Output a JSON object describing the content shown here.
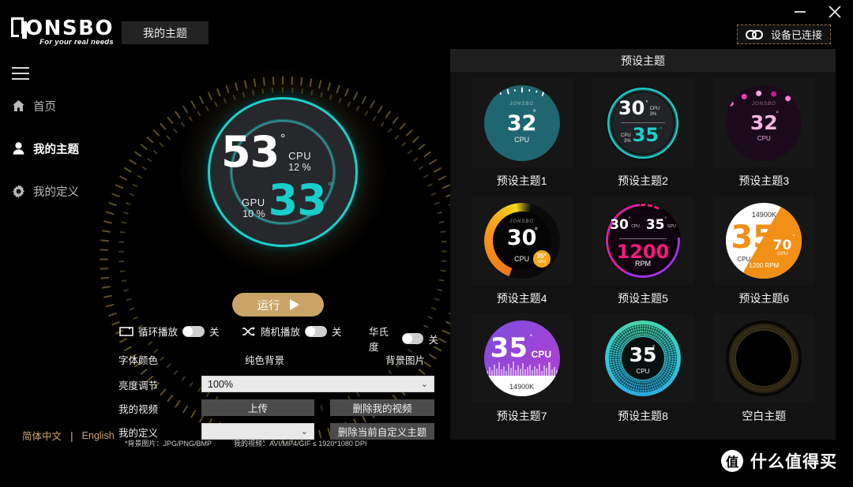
{
  "window": {
    "minimize": "–",
    "close": "✕"
  },
  "brand": {
    "name": "ONSBO",
    "tagline": "For your real needs"
  },
  "tab": {
    "label": "我的主题"
  },
  "device": {
    "status": "设备已连接",
    "icon": "link-icon"
  },
  "sidebar": {
    "menu_icon": "hamburger-icon",
    "items": [
      {
        "label": "首页",
        "icon": "home-icon",
        "active": false
      },
      {
        "label": "我的主题",
        "icon": "user-icon",
        "active": true
      },
      {
        "label": "我的定义",
        "icon": "gear-icon",
        "active": false
      }
    ]
  },
  "language": {
    "zh": "简体中文",
    "sep": "|",
    "en": "English"
  },
  "preview": {
    "cpu_value": "53",
    "cpu_degree": "°",
    "cpu_label": "CPU",
    "cpu_load": "12 %",
    "gpu_value": "33",
    "gpu_degree": "°",
    "gpu_label": "GPU",
    "gpu_load": "10 %",
    "accent": "#19cfcc",
    "ring": "#6d5a2d"
  },
  "run_button": {
    "label": "运行",
    "icon": "play-icon",
    "color": "#c9a367"
  },
  "toggles": [
    {
      "label": "循环播放",
      "state": "关",
      "icon": "loop-icon"
    },
    {
      "label": "随机播放",
      "state": "关",
      "icon": "shuffle-icon"
    },
    {
      "label": "华氏度",
      "state": "关",
      "icon": "none"
    }
  ],
  "option_labels": [
    "字体颜色",
    "纯色背景",
    "背景图片"
  ],
  "form": {
    "brightness": {
      "label": "亮度调节",
      "value": "100%",
      "placeholder": "100%"
    },
    "my_video": {
      "label": "我的视频",
      "upload": "上传",
      "delete": "删除我的视频"
    },
    "my_custom": {
      "label": "我的定义",
      "value": "",
      "placeholder": "",
      "delete": "删除当前自定义主题"
    }
  },
  "notes": [
    "*背景图片：JPG/PNG/BMP",
    "我的视频：AVI/MP4/GIF ≤ 1920*1080 DPI"
  ],
  "presets": {
    "title": "预设主题",
    "items": [
      {
        "id": "t1",
        "caption": "预设主题1",
        "brand": "JONSBO",
        "value": "32",
        "degree": "°",
        "label": "CPU"
      },
      {
        "id": "t2",
        "caption": "预设主题2",
        "value1": "30",
        "unit1": "CPU",
        "load1": "3%",
        "value2": "35",
        "unit2": "CPU",
        "load2": "3%"
      },
      {
        "id": "t3",
        "caption": "预设主题3",
        "brand": "JONSBO",
        "value": "32",
        "degree": "°",
        "label": "CPU"
      },
      {
        "id": "t4",
        "caption": "预设主题4",
        "brand": "JONSBO",
        "value": "30",
        "degree": "°",
        "label": "CPU",
        "bubble_value": "35°",
        "bubble_label": "GPU"
      },
      {
        "id": "t5",
        "caption": "预设主题5",
        "value1": "30",
        "unit1": "CPU",
        "value2": "35",
        "unit2": "GPU",
        "rpm_value": "1200",
        "rpm_label": "RPM"
      },
      {
        "id": "t6",
        "caption": "预设主题6",
        "model": "14900K",
        "value": "35",
        "degree": "°",
        "label": "CPU",
        "gpu_value": "70",
        "gpu_degree": "°",
        "gpu_label": "GPU",
        "rpm": "1200 RPM"
      },
      {
        "id": "t7",
        "caption": "预设主题7",
        "value": "35",
        "degree": "°",
        "label": "CPU",
        "model": "14900K"
      },
      {
        "id": "t8",
        "caption": "预设主题8",
        "value": "35",
        "degree": "°",
        "label": "CPU"
      },
      {
        "id": "t9",
        "caption": "空白主题"
      }
    ]
  },
  "watermark": {
    "badge": "值",
    "text": "什么值得买"
  }
}
